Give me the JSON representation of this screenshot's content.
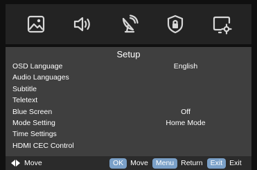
{
  "tabs": [
    {
      "icon": "picture-icon"
    },
    {
      "icon": "sound-icon"
    },
    {
      "icon": "channel-icon"
    },
    {
      "icon": "lock-icon"
    },
    {
      "icon": "setup-icon"
    }
  ],
  "setup": {
    "title": "Setup",
    "items": [
      {
        "label": "OSD Language",
        "value": "English"
      },
      {
        "label": "Audio Languages",
        "value": ""
      },
      {
        "label": "Subtitle",
        "value": ""
      },
      {
        "label": "Teletext",
        "value": ""
      },
      {
        "label": "Blue Screen",
        "value": "Off"
      },
      {
        "label": "Mode Setting",
        "value": "Home Mode"
      },
      {
        "label": "Time Settings",
        "value": ""
      },
      {
        "label": "HDMI CEC Control",
        "value": ""
      }
    ]
  },
  "footer": {
    "move_label": "Move",
    "ok_key": "OK",
    "ok_label": "Move",
    "menu_key": "Menu",
    "menu_label": "Return",
    "exit_key": "Exit",
    "exit_label": "Exit"
  },
  "colors": {
    "panel": "#3f3f3f",
    "topbar": "#232323",
    "key_button": "#7aa0c8"
  }
}
